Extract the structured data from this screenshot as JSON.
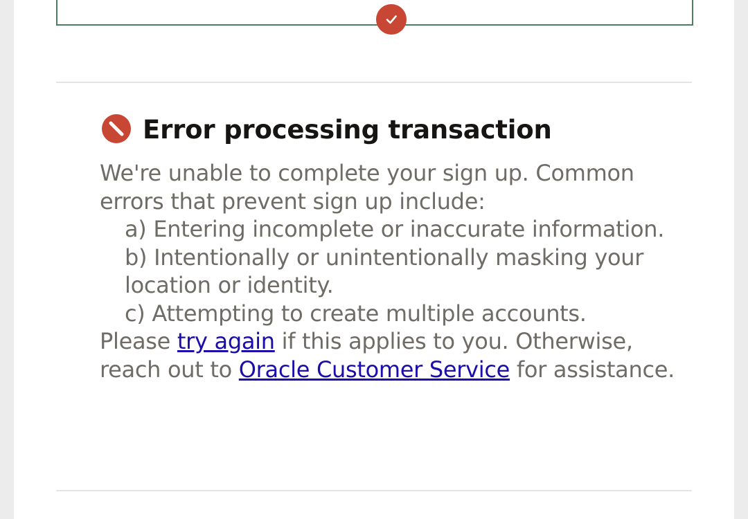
{
  "colors": {
    "brand_red": "#c74634",
    "step_border_green": "#4b7f5f",
    "link_blue": "#1a0dab",
    "body_text": "#6f6c67",
    "title_text": "#161513"
  },
  "step_indicator": {
    "icon": "checkmark-icon",
    "status": "complete"
  },
  "error": {
    "icon": "no-entry-icon",
    "title": "Error processing transaction",
    "intro": "We're unable to complete your sign up. Common errors that prevent sign up include:",
    "reasons": [
      "a) Entering incomplete or inaccurate information.",
      "b) Intentionally or unintentionally masking your location or identity.",
      "c) Attempting to create multiple accounts."
    ],
    "closing_prefix": "Please ",
    "try_again_link": "try again",
    "closing_middle": " if this applies to you. Otherwise, reach out to ",
    "customer_service_link": "Oracle Customer Service",
    "closing_suffix": " for assistance."
  }
}
